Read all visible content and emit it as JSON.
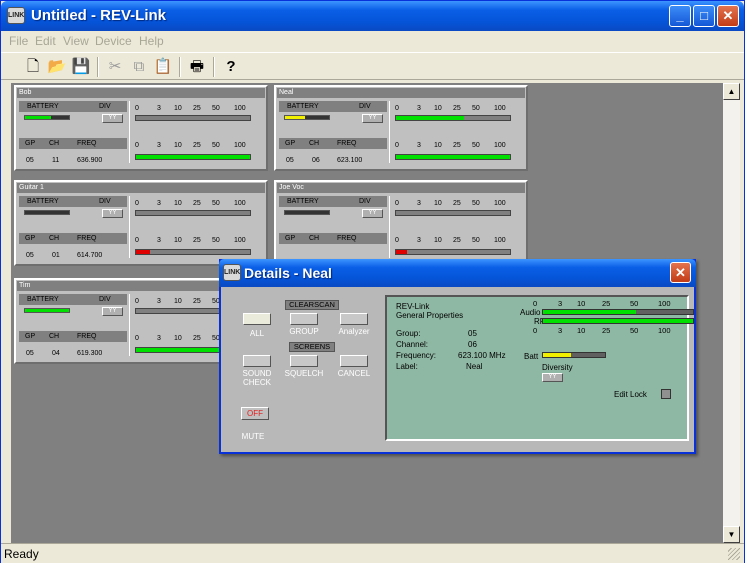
{
  "app": {
    "title": "Untitled - REV-Link",
    "icon_text": "LINK",
    "status": "Ready"
  },
  "window_controls": {
    "minimize": "_",
    "maximize": "□",
    "close": "✕"
  },
  "menu": [
    "File",
    "Edit",
    "View",
    "Device",
    "Help"
  ],
  "toolbar": {
    "icons": [
      "new-icon",
      "open-icon",
      "save-icon",
      "cut-icon",
      "copy-icon",
      "paste-icon",
      "print-icon",
      "help-icon"
    ],
    "glyphs": [
      "🗋",
      "📂",
      "💾",
      "✂",
      "⧉",
      "📋",
      "🖶",
      "?"
    ]
  },
  "scrollbar": {
    "up": "▲",
    "down": "▼"
  },
  "panel_labels": {
    "battery": "BATTERY",
    "div": "DIV",
    "div_icon": "YY",
    "gp": "GP",
    "ch": "CH",
    "freq": "FREQ",
    "scale": [
      "0",
      "3",
      "10",
      "25",
      "50",
      "100"
    ]
  },
  "receivers": [
    {
      "name": "Bob",
      "group": "05",
      "channel": "11",
      "frequency": "636.900",
      "battery_level": 0.6,
      "battery_color": "#00e000",
      "audio_level": 0.0,
      "rf_level": 1.0,
      "rf_color": "#00e000"
    },
    {
      "name": "Neal",
      "group": "05",
      "channel": "06",
      "frequency": "623.100",
      "battery_level": 0.45,
      "battery_color": "#f0f000",
      "audio_level": 0.6,
      "rf_level": 1.0,
      "rf_color": "#00e000"
    },
    {
      "name": "Guitar 1",
      "group": "05",
      "channel": "01",
      "frequency": "614.700",
      "battery_level": 0.0,
      "battery_color": "#00e000",
      "audio_level": 0.0,
      "rf_level": 0.12,
      "rf_color": "#e00000"
    },
    {
      "name": "Joe Voc",
      "group": "",
      "channel": "",
      "frequency": "",
      "battery_level": 0.0,
      "battery_color": "#00e000",
      "audio_level": 0.0,
      "rf_level": 0.1,
      "rf_color": "#e00000"
    },
    {
      "name": "Tim",
      "group": "05",
      "channel": "04",
      "frequency": "619.300",
      "battery_level": 1.0,
      "battery_color": "#00e000",
      "audio_level": 0.0,
      "rf_level": 1.0,
      "rf_color": "#00e000"
    }
  ],
  "dialog": {
    "title": "Details - Neal",
    "close": "✕",
    "clearscan": "CLEARSCAN",
    "screens": "SCREENS",
    "buttons": {
      "all": "ALL",
      "group": "GROUP",
      "analyzer": "Analyzer",
      "sound_check": "SOUND CHECK",
      "squelch": "SQUELCH",
      "cancel": "CANCEL"
    },
    "off": "OFF",
    "mute": "MUTE",
    "properties": {
      "device": "REV-Link",
      "subtitle": "General Properties",
      "group_label": "Group:",
      "group": "05",
      "channel_label": "Channel:",
      "channel": "06",
      "frequency_label": "Frequency:",
      "frequency": "623.100 MHz",
      "label_label": "Label:",
      "label": "Neal",
      "audio_label": "Audio",
      "rf_label": "RF",
      "batt_label": "Batt",
      "diversity_label": "Diversity",
      "diversity_icon": "YY",
      "edit_lock": "Edit Lock",
      "audio_level": 0.62,
      "rf_level": 1.0,
      "batt_level": 0.45,
      "scale": [
        "0",
        "3",
        "10",
        "25",
        "50",
        "100"
      ]
    }
  }
}
